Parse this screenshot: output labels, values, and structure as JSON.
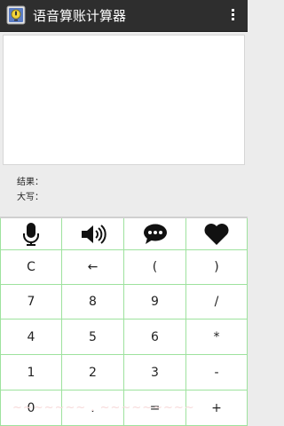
{
  "app": {
    "title": "语音算账计算器",
    "icon": "calculator-app-icon",
    "menu_icon": "overflow-menu-icon"
  },
  "input": {
    "text": ""
  },
  "results": {
    "result_label": "结果：",
    "uppercase_label": "大写："
  },
  "colors": {
    "action_bar": "#2e2e2e",
    "grid_line": "#9ee29e",
    "background": "#ececec",
    "key_text": "#222222"
  },
  "icon_row": [
    {
      "name": "microphone-icon"
    },
    {
      "name": "speaker-icon"
    },
    {
      "name": "chat-bubble-icon"
    },
    {
      "name": "heart-icon"
    }
  ],
  "keys": [
    [
      "C",
      "←",
      "(",
      ")"
    ],
    [
      "7",
      "8",
      "9",
      "/"
    ],
    [
      "4",
      "5",
      "6",
      "*"
    ],
    [
      "1",
      "2",
      "3",
      "-"
    ],
    [
      "0",
      ".",
      "=",
      "+"
    ]
  ]
}
